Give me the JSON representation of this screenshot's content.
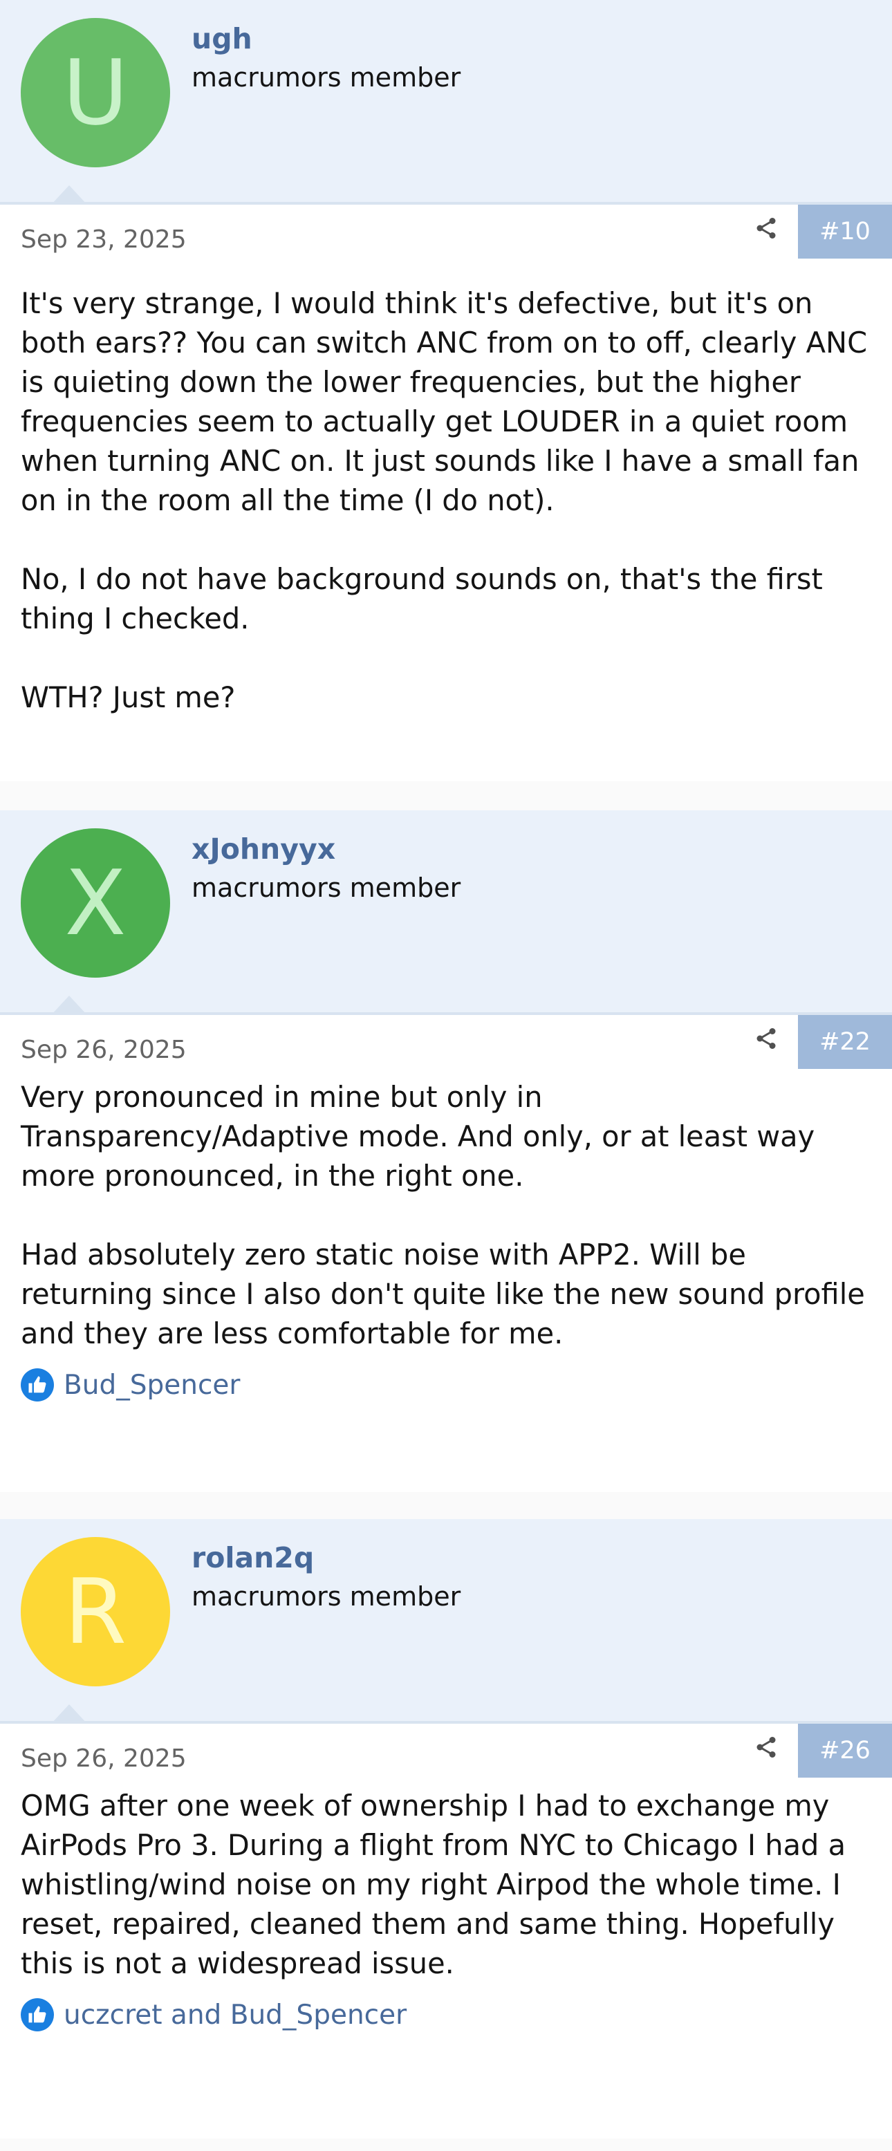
{
  "posts": [
    {
      "avatar_letter": "U",
      "username": "ugh",
      "user_title": "macrumors member",
      "date": "Sep 23, 2025",
      "post_number": "#10",
      "paragraphs": [
        "It's very strange, I would think it's defective, but it's on both ears?? You can switch ANC from on to off, clearly ANC is quieting down the lower frequencies, but the higher frequencies seem to actually get LOUDER in a quiet room when turning ANC on. It just sounds like I have a small fan on in the room all the time (I do not).",
        "No, I do not have background sounds on, that's the first thing I checked.",
        "WTH? Just me?"
      ],
      "reactions": null
    },
    {
      "avatar_letter": "X",
      "username": "xJohnyyx",
      "user_title": "macrumors member",
      "date": "Sep 26, 2025",
      "post_number": "#22",
      "paragraphs": [
        "Very pronounced in mine but only in Transparency/Adaptive mode. And only, or at least way more pronounced, in the right one.",
        "Had absolutely zero static noise with APP2. Will be returning since I also don't quite like the new sound profile and they are less comfortable for me."
      ],
      "reactions": "Bud_Spencer"
    },
    {
      "avatar_letter": "R",
      "username": "rolan2q",
      "user_title": "macrumors member",
      "date": "Sep 26, 2025",
      "post_number": "#26",
      "paragraphs": [
        "OMG after one week of ownership I had to exchange my AirPods Pro 3. During a flight from NYC to Chicago I had a whistling/wind noise on my right Airpod the whole time. I reset, repaired, cleaned them and same thing. Hopefully this is not a widespread issue."
      ],
      "reactions": "uczcret and Bud_Spencer"
    }
  ],
  "icons": {
    "share": "share-icon",
    "like": "thumbs-up-icon"
  },
  "colors": {
    "header_bg": "#eaf1fa",
    "username": "#47699a",
    "post_number_bg": "#9fb9da",
    "like_blue": "#1a7fe0"
  }
}
